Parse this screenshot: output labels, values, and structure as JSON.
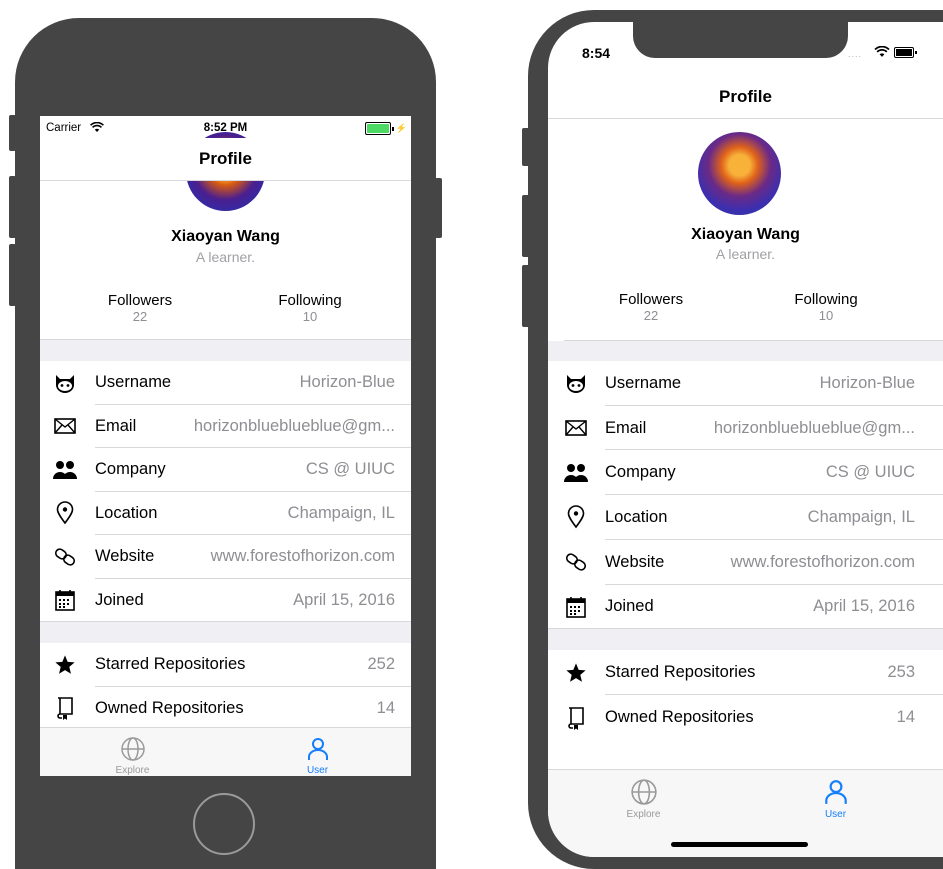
{
  "colors": {
    "device": "#454545",
    "accent": "#147efb",
    "separator": "#d8d8dc",
    "secondary_text": "#8e8e93",
    "group_bg": "#efeff4",
    "battery": "#4cd964"
  },
  "left_phone": {
    "status": {
      "carrier": "Carrier",
      "time": "8:52 PM"
    },
    "nav_title": "Profile",
    "name": "Xiaoyan Wang",
    "bio": "A learner.",
    "followers": {
      "label": "Followers",
      "count": "22"
    },
    "following": {
      "label": "Following",
      "count": "10"
    },
    "info": [
      {
        "icon": "octocat-icon",
        "label": "Username",
        "value": "Horizon-Blue"
      },
      {
        "icon": "envelope-icon",
        "label": "Email",
        "value": "horizonblueblueblue@gm..."
      },
      {
        "icon": "people-icon",
        "label": "Company",
        "value": "CS @ UIUC"
      },
      {
        "icon": "location-pin-icon",
        "label": "Location",
        "value": "Champaign, IL"
      },
      {
        "icon": "link-icon",
        "label": "Website",
        "value": "www.forestofhorizon.com"
      },
      {
        "icon": "calendar-icon",
        "label": "Joined",
        "value": "April 15, 2016"
      }
    ],
    "repos": [
      {
        "icon": "star-icon",
        "label": "Starred Repositories",
        "value": "252"
      },
      {
        "icon": "repo-book-icon",
        "label": "Owned Repositories",
        "value": "14"
      }
    ],
    "tabs": [
      {
        "label": "Explore",
        "icon": "globe-icon",
        "active": false
      },
      {
        "label": "User",
        "icon": "user-icon",
        "active": true
      }
    ]
  },
  "right_phone": {
    "status": {
      "time": "8:54"
    },
    "nav_title": "Profile",
    "name": "Xiaoyan Wang",
    "bio": "A learner.",
    "followers": {
      "label": "Followers",
      "count": "22"
    },
    "following": {
      "label": "Following",
      "count": "10"
    },
    "info": [
      {
        "icon": "octocat-icon",
        "label": "Username",
        "value": "Horizon-Blue"
      },
      {
        "icon": "envelope-icon",
        "label": "Email",
        "value": "horizonblueblueblue@gm..."
      },
      {
        "icon": "people-icon",
        "label": "Company",
        "value": "CS @ UIUC"
      },
      {
        "icon": "location-pin-icon",
        "label": "Location",
        "value": "Champaign, IL"
      },
      {
        "icon": "link-icon",
        "label": "Website",
        "value": "www.forestofhorizon.com"
      },
      {
        "icon": "calendar-icon",
        "label": "Joined",
        "value": "April 15, 2016"
      }
    ],
    "repos": [
      {
        "icon": "star-icon",
        "label": "Starred Repositories",
        "value": "253"
      },
      {
        "icon": "repo-book-icon",
        "label": "Owned Repositories",
        "value": "14"
      }
    ],
    "tabs": [
      {
        "label": "Explore",
        "icon": "globe-icon",
        "active": false
      },
      {
        "label": "User",
        "icon": "user-icon",
        "active": true
      }
    ]
  }
}
